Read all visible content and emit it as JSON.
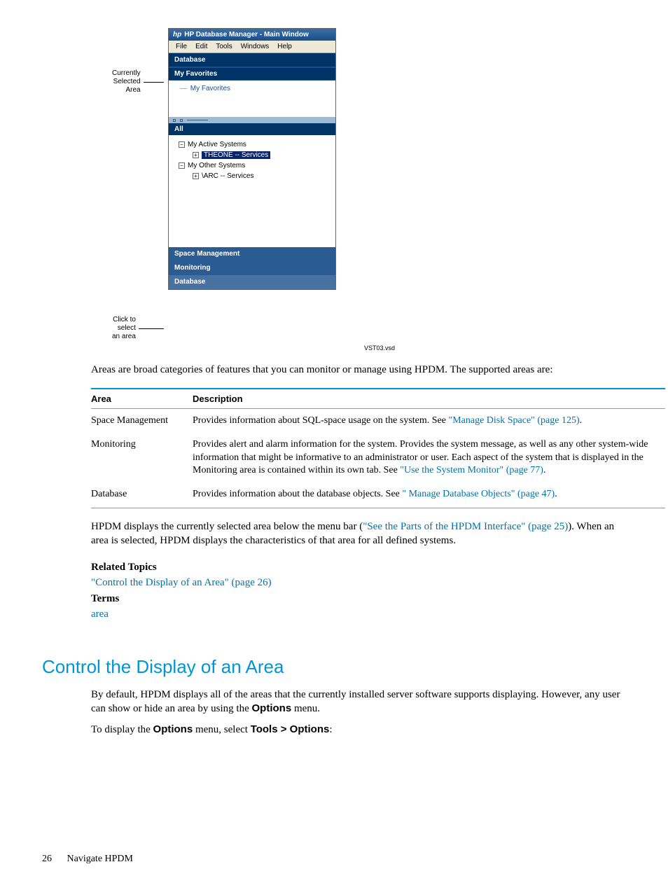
{
  "figure": {
    "annot_top": "Currently\nSelected\nArea",
    "annot_bottom": "Click to\nselect\nan area",
    "title_prefix": "hp",
    "title": "HP Database Manager - Main Window",
    "menus": [
      "File",
      "Edit",
      "Tools",
      "Windows",
      "Help"
    ],
    "panel_database": "Database",
    "panel_myfav": "My Favorites",
    "fav_item": "My Favorites",
    "panel_all": "All",
    "tree": {
      "n0": "My Active Systems",
      "n0c": "THEONE -- Services",
      "n1": "My Other Systems",
      "n1c": "\\ARC -- Services"
    },
    "panel_space": "Space Management",
    "panel_monitor": "Monitoring",
    "panel_db2": "Database",
    "vsd": "VST03.vsd"
  },
  "para1": "Areas are broad categories of features that you can monitor or manage using HPDM. The supported areas are:",
  "table": {
    "h0": "Area",
    "h1": "Description",
    "rows": [
      {
        "area": "Space Management",
        "desc": "Provides information about SQL-space usage on the system. See ",
        "link": "\"Manage Disk Space\" (page 125)",
        "tail": "."
      },
      {
        "area": "Monitoring",
        "desc": "Provides alert and alarm information for the system. Provides the system message, as well as any other system-wide information that might be informative to an administrator or user. Each aspect of the system that is displayed in the Monitoring area is contained within its own tab. See ",
        "link": "\"Use the System Monitor\" (page 77)",
        "tail": "."
      },
      {
        "area": "Database",
        "desc": "Provides information about the database objects. See ",
        "link": "\" Manage Database Objects\" (page 47)",
        "tail": "."
      }
    ]
  },
  "para2a": "HPDM displays the currently selected area below the menu bar (",
  "para2_link": "\"See the Parts of the HPDM Interface\" (page 25)",
  "para2b": "). When an area is selected, HPDM displays the characteristics of that area for all defined systems.",
  "related": {
    "heading": "Related Topics",
    "link": "\"Control the Display of an Area\" (page 26)",
    "terms_heading": "Terms",
    "term": "area"
  },
  "section_heading": "Control the Display of an Area",
  "instr1a": "By default, HPDM displays all of the areas that the currently installed server software supports displaying. However, any user can show or hide an area by using the ",
  "instr1_ui": "Options",
  "instr1b": " menu.",
  "instr2a": "To display the ",
  "instr2_ui1": "Options",
  "instr2b": " menu, select ",
  "instr2_ui2": "Tools > Options",
  "instr2c": ":",
  "footer": {
    "page": "26",
    "chapter": "Navigate HPDM"
  }
}
